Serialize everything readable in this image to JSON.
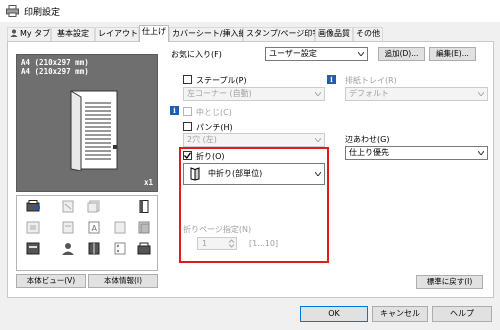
{
  "window": {
    "title": "印刷設定"
  },
  "tabs": [
    {
      "label": "My タブ",
      "icon": "user-icon"
    },
    {
      "label": "基本設定"
    },
    {
      "label": "レイアウト"
    },
    {
      "label": "仕上げ",
      "active": true
    },
    {
      "label": "カバーシート/挿入紙"
    },
    {
      "label": "スタンプ/ページ印字"
    },
    {
      "label": "画像品質"
    },
    {
      "label": "その他"
    }
  ],
  "favorites": {
    "label": "お気に入り(F)",
    "value": "ユーザー設定",
    "add_label": "追加(D)...",
    "edit_label": "編集(E)..."
  },
  "preview": {
    "line1": "A4 (210x297 mm)",
    "line2": "A4 (210x297 mm)",
    "scale": "x1"
  },
  "preview_buttons": {
    "printer_view": "本体ビュー(V)",
    "printer_info": "本体情報(I)"
  },
  "staple": {
    "label": "ステープル(P)",
    "value": "左コーナー (自動)"
  },
  "saddle_stitch": {
    "label": "中とじ(C)"
  },
  "punch": {
    "label": "パンチ(H)",
    "value": "2穴 (左)"
  },
  "fold": {
    "label": "折り(O)",
    "value": "中折り(部単位)",
    "pages_label": "折りページ指定(N)",
    "pages_value": "1",
    "pages_range": "[1...10]"
  },
  "output_tray": {
    "label": "排紙トレイ(R)",
    "value": "デフォルト"
  },
  "collate": {
    "label": "辺あわせ(G)",
    "value": "仕上り優先"
  },
  "restore_button": "標準に戻す(I)",
  "footer": {
    "ok": "OK",
    "cancel": "キャンセル",
    "help": "ヘルプ"
  },
  "colors": {
    "highlight": "#e01b1b",
    "info": "#1a5fb4",
    "preview_bg": "#6f6f6f"
  }
}
